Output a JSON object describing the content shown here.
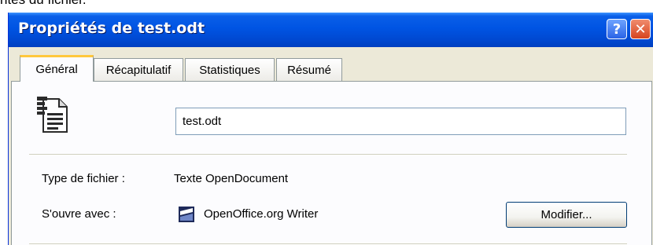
{
  "caption": "ntés du fichier.",
  "window": {
    "title": "Propriétés de test.odt",
    "help_label": "?",
    "close_label": "✕"
  },
  "tabs": [
    {
      "label": "Général",
      "active": true
    },
    {
      "label": "Récapitulatif",
      "active": false
    },
    {
      "label": "Statistiques",
      "active": false
    },
    {
      "label": "Résumé",
      "active": false
    }
  ],
  "general": {
    "file_icon": "odt-document-icon",
    "file_name": "test.odt",
    "type_label": "Type de fichier :",
    "type_value": "Texte OpenDocument",
    "opens_with_label": "S'ouvre avec :",
    "app_icon": "openoffice-writer-icon",
    "opens_with_value": "OpenOffice.org Writer",
    "modify_button": "Modifier..."
  },
  "colors": {
    "titlebar": "#0054e3",
    "dialog_bg": "#ece9d8",
    "panel_bg": "#fcfcfe",
    "active_tab_accent": "#ffc83c",
    "close_button": "#d6431e"
  }
}
